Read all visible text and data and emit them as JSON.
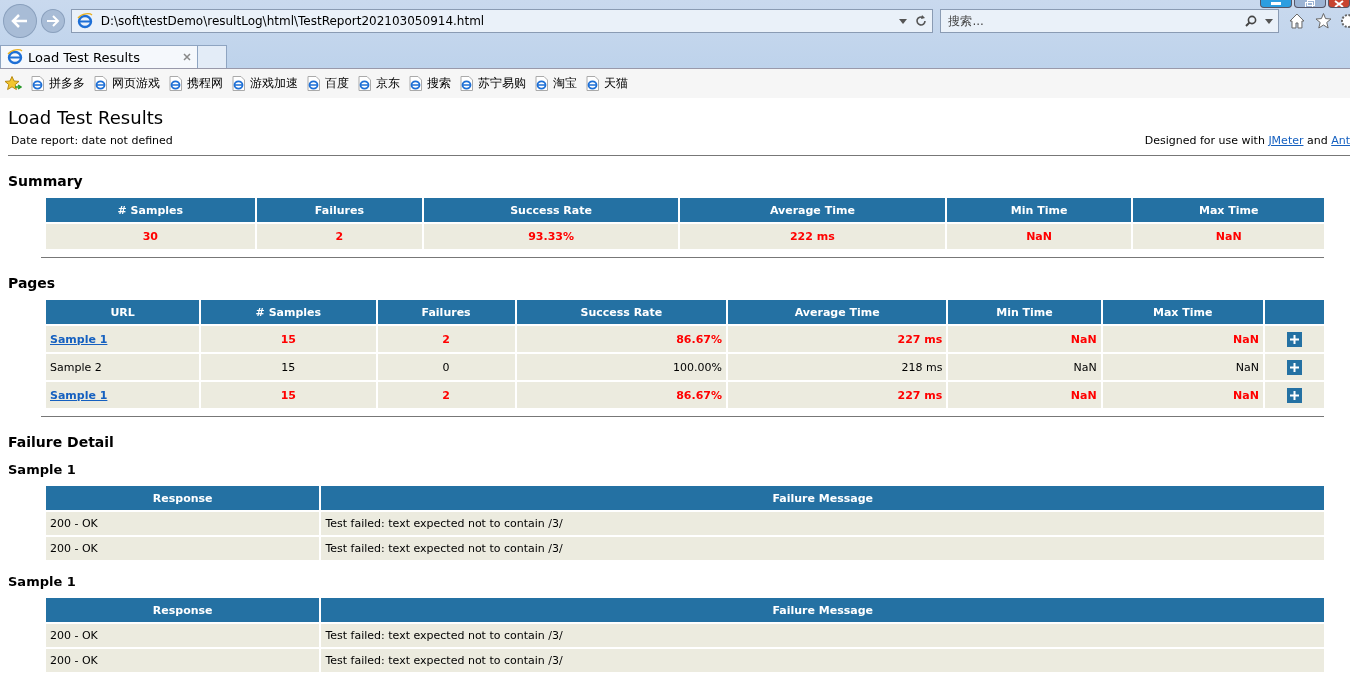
{
  "browser": {
    "address": "D:\\soft\\testDemo\\resultLog\\html\\TestReport202103050914.html",
    "search_placeholder": "搜索...",
    "tabs": [
      {
        "title": "Load Test Results",
        "selected": true
      }
    ],
    "favorites": [
      "拼多多",
      "网页游戏",
      "携程网",
      "游戏加速",
      "百度",
      "京东",
      "搜索",
      "苏宁易购",
      "淘宝",
      "天猫"
    ]
  },
  "report": {
    "title": "Load Test Results",
    "date": "Date report: date not defined",
    "designed_text": "Designed for use with",
    "link_1": "JMeter",
    "and_text": "and",
    "link_2": "Ant"
  },
  "summary": {
    "heading": "Summary",
    "columns": [
      "# Samples",
      "Failures",
      "Success Rate",
      "Average Time",
      "Min Time",
      "Max Time"
    ],
    "row": {
      "failed": true,
      "cells": [
        "30",
        "2",
        "93.33%",
        "222 ms",
        "NaN",
        "NaN"
      ]
    }
  },
  "pages": {
    "heading": "Pages",
    "columns": [
      "URL",
      "# Samples",
      "Failures",
      "Success Rate",
      "Average Time",
      "Min Time",
      "Max Time"
    ],
    "rows": [
      {
        "failed": true,
        "cells": [
          "Sample 1",
          "15",
          "2",
          "86.67%",
          "227 ms",
          "NaN",
          "NaN"
        ]
      },
      {
        "failed": false,
        "cells": [
          "Sample 2",
          "15",
          "0",
          "100.00%",
          "218 ms",
          "NaN",
          "NaN"
        ]
      },
      {
        "failed": true,
        "cells": [
          "Sample 1",
          "15",
          "2",
          "86.67%",
          "227 ms",
          "NaN",
          "NaN"
        ]
      }
    ]
  },
  "failure_detail": {
    "heading": "Failure Detail",
    "groups": [
      {
        "title": "Sample 1",
        "columns": [
          "Response",
          "Failure Message"
        ],
        "rows": [
          [
            "200 - OK",
            "Test failed: text expected not to contain /3/"
          ],
          [
            "200 - OK",
            "Test failed: text expected not to contain /3/"
          ]
        ]
      },
      {
        "title": "Sample 1",
        "columns": [
          "Response",
          "Failure Message"
        ],
        "rows": [
          [
            "200 - OK",
            "Test failed: text expected not to contain /3/"
          ],
          [
            "200 - OK",
            "Test failed: text expected not to contain /3/"
          ]
        ]
      }
    ]
  }
}
